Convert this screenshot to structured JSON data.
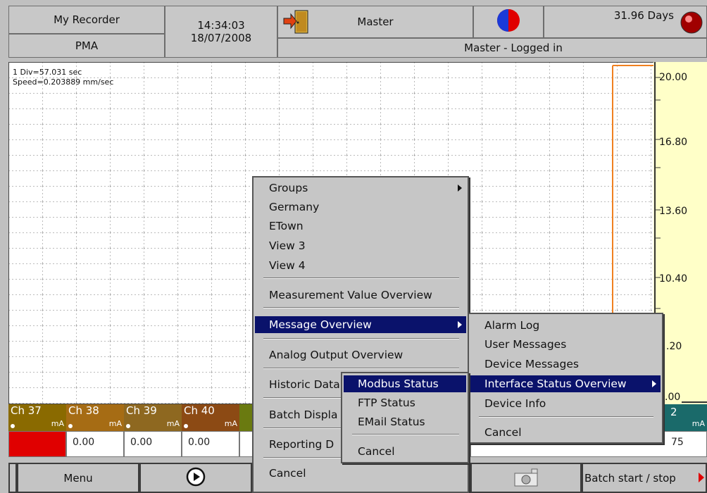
{
  "header": {
    "recorder_name": "My Recorder",
    "group_name": "PMA",
    "time": "14:34:03",
    "date": "18/07/2008",
    "user": "Master",
    "login_status": "Master - Logged in",
    "remaining": "31.96 Days"
  },
  "chart": {
    "division": "1 Div=57.031 sec",
    "speed": "Speed=0.203889 mm/sec",
    "scale_ticks": [
      "20.00",
      "16.80",
      "13.60",
      "10.40",
      ".20",
      ".00"
    ]
  },
  "channels": [
    {
      "name": "Ch 37",
      "unit": "mA",
      "value": "",
      "color": "#8a6a00"
    },
    {
      "name": "Ch 38",
      "unit": "mA",
      "value": "0.00",
      "color": "#a66c14"
    },
    {
      "name": "Ch 39",
      "unit": "mA",
      "value": "0.00",
      "color": "#8e6820"
    },
    {
      "name": "Ch 40",
      "unit": "mA",
      "value": "0.00",
      "color": "#8c4a14"
    }
  ],
  "channel_right": {
    "name": "2",
    "unit": "mA",
    "value": "75"
  },
  "bottom": {
    "menu": "Menu",
    "batch": "Batch start / stop"
  },
  "main_menu": {
    "items": [
      "Groups",
      "Germany",
      "ETown",
      "View 3",
      "View 4",
      "Measurement Value Overview",
      "Message Overview",
      "Analog Output Overview",
      "Historic Data",
      "Batch Displa",
      "Reporting D",
      "Cancel"
    ]
  },
  "message_menu": {
    "items": [
      "Alarm Log",
      "User Messages",
      "Device Messages",
      "Interface Status Overview",
      "Device Info",
      "Cancel"
    ]
  },
  "interface_menu": {
    "items": [
      "Modbus Status",
      "FTP Status",
      "EMail Status",
      "Cancel"
    ]
  },
  "colors": {
    "menu_highlight": "#0a126b",
    "alarm_red": "#e00000",
    "trace_orange": "#f08020",
    "scale_bg": "#ffffc8"
  }
}
